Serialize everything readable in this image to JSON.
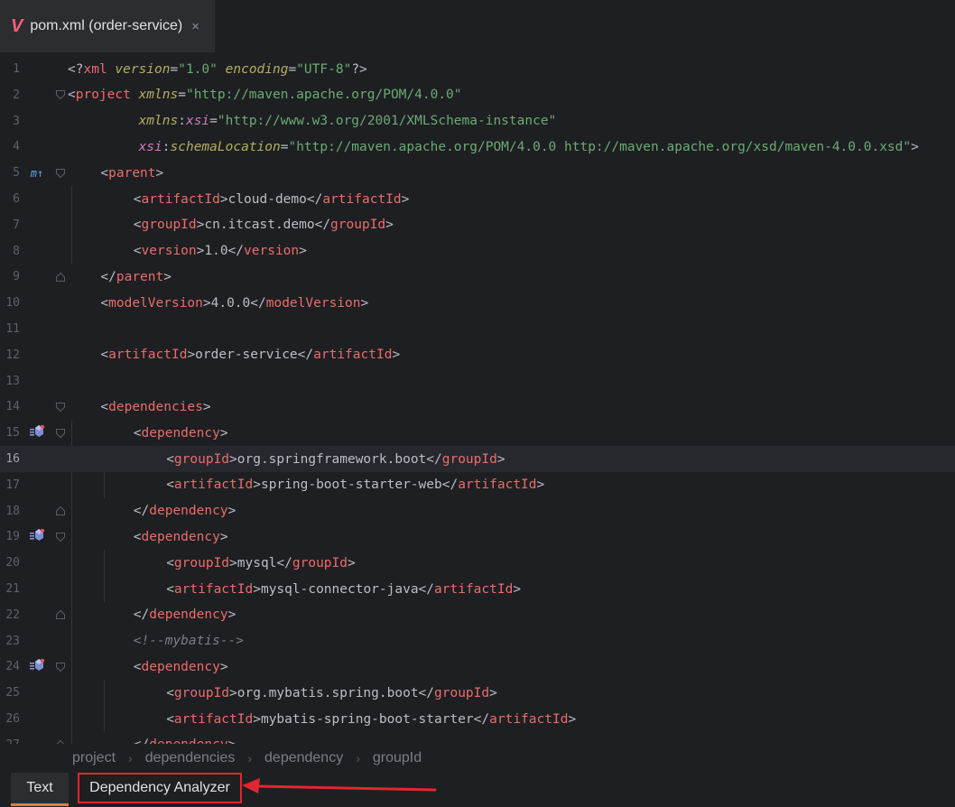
{
  "tab": {
    "logo": "V",
    "title": "pom.xml (order-service)",
    "close": "×"
  },
  "editor": {
    "current_line": 16,
    "lines": [
      {
        "n": "1",
        "indent": 0,
        "parts": [
          [
            "b",
            "<?"
          ],
          [
            "t",
            "xml "
          ],
          [
            "a",
            "version"
          ],
          [
            "b",
            "="
          ],
          [
            "v",
            "\"1.0\" "
          ],
          [
            "a",
            "encoding"
          ],
          [
            "b",
            "="
          ],
          [
            "v",
            "\"UTF-8\""
          ],
          [
            "b",
            "?>"
          ]
        ]
      },
      {
        "n": "2",
        "indent": 0,
        "fold": "open",
        "parts": [
          [
            "b",
            "<"
          ],
          [
            "t",
            "project "
          ],
          [
            "a",
            "xmlns"
          ],
          [
            "b",
            "="
          ],
          [
            "v",
            "\"http://maven.apache.org/POM/4.0.0\""
          ]
        ]
      },
      {
        "n": "3",
        "indent": 0,
        "parts": [
          [
            "b",
            "         "
          ],
          [
            "a",
            "xmlns"
          ],
          [
            "b",
            ":"
          ],
          [
            "n",
            "xsi"
          ],
          [
            "b",
            "="
          ],
          [
            "v",
            "\"http://www.w3.org/2001/XMLSchema-instance\""
          ]
        ]
      },
      {
        "n": "4",
        "indent": 0,
        "parts": [
          [
            "b",
            "         "
          ],
          [
            "n",
            "xsi"
          ],
          [
            "b",
            ":"
          ],
          [
            "a",
            "schemaLocation"
          ],
          [
            "b",
            "="
          ],
          [
            "v",
            "\"http://maven.apache.org/POM/4.0.0 http://maven.apache.org/xsd/maven-4.0.0.xsd\""
          ],
          [
            "b",
            ">"
          ]
        ]
      },
      {
        "n": "5",
        "indent": 1,
        "fold": "open",
        "gicon": "m↑",
        "parts": [
          [
            "b",
            "<"
          ],
          [
            "t",
            "parent"
          ],
          [
            "b",
            ">"
          ]
        ]
      },
      {
        "n": "6",
        "indent": 2,
        "parts": [
          [
            "b",
            "<"
          ],
          [
            "t",
            "artifactId"
          ],
          [
            "b",
            ">cloud-demo</"
          ],
          [
            "t",
            "artifactId"
          ],
          [
            "b",
            ">"
          ]
        ]
      },
      {
        "n": "7",
        "indent": 2,
        "parts": [
          [
            "b",
            "<"
          ],
          [
            "t",
            "groupId"
          ],
          [
            "b",
            ">cn.itcast.demo</"
          ],
          [
            "t",
            "groupId"
          ],
          [
            "b",
            ">"
          ]
        ]
      },
      {
        "n": "8",
        "indent": 2,
        "parts": [
          [
            "b",
            "<"
          ],
          [
            "t",
            "version"
          ],
          [
            "b",
            ">1.0</"
          ],
          [
            "t",
            "version"
          ],
          [
            "b",
            ">"
          ]
        ]
      },
      {
        "n": "9",
        "indent": 1,
        "fold": "close",
        "parts": [
          [
            "b",
            "</"
          ],
          [
            "t",
            "parent"
          ],
          [
            "b",
            ">"
          ]
        ]
      },
      {
        "n": "10",
        "indent": 1,
        "parts": [
          [
            "b",
            "<"
          ],
          [
            "t",
            "modelVersion"
          ],
          [
            "b",
            ">4.0.0</"
          ],
          [
            "t",
            "modelVersion"
          ],
          [
            "b",
            ">"
          ]
        ]
      },
      {
        "n": "11",
        "indent": 0,
        "parts": []
      },
      {
        "n": "12",
        "indent": 1,
        "parts": [
          [
            "b",
            "<"
          ],
          [
            "t",
            "artifactId"
          ],
          [
            "b",
            ">order-service</"
          ],
          [
            "t",
            "artifactId"
          ],
          [
            "b",
            ">"
          ]
        ]
      },
      {
        "n": "13",
        "indent": 0,
        "parts": []
      },
      {
        "n": "14",
        "indent": 1,
        "fold": "open",
        "parts": [
          [
            "b",
            "<"
          ],
          [
            "t",
            "dependencies"
          ],
          [
            "b",
            ">"
          ]
        ]
      },
      {
        "n": "15",
        "indent": 2,
        "fold": "open",
        "gicon": "dep",
        "parts": [
          [
            "b",
            "<"
          ],
          [
            "t",
            "dependency"
          ],
          [
            "b",
            ">"
          ]
        ]
      },
      {
        "n": "16",
        "indent": 3,
        "parts": [
          [
            "b",
            "<"
          ],
          [
            "t",
            "groupId"
          ],
          [
            "b",
            ">org.springframework.boot</"
          ],
          [
            "t",
            "groupId"
          ],
          [
            "b",
            ">"
          ]
        ]
      },
      {
        "n": "17",
        "indent": 3,
        "parts": [
          [
            "b",
            "<"
          ],
          [
            "t",
            "artifactId"
          ],
          [
            "b",
            ">spring-boot-starter-web</"
          ],
          [
            "t",
            "artifactId"
          ],
          [
            "b",
            ">"
          ]
        ]
      },
      {
        "n": "18",
        "indent": 2,
        "fold": "close",
        "parts": [
          [
            "b",
            "</"
          ],
          [
            "t",
            "dependency"
          ],
          [
            "b",
            ">"
          ]
        ]
      },
      {
        "n": "19",
        "indent": 2,
        "fold": "open",
        "gicon": "dep",
        "parts": [
          [
            "b",
            "<"
          ],
          [
            "t",
            "dependency"
          ],
          [
            "b",
            ">"
          ]
        ]
      },
      {
        "n": "20",
        "indent": 3,
        "parts": [
          [
            "b",
            "<"
          ],
          [
            "t",
            "groupId"
          ],
          [
            "b",
            ">mysql</"
          ],
          [
            "t",
            "groupId"
          ],
          [
            "b",
            ">"
          ]
        ]
      },
      {
        "n": "21",
        "indent": 3,
        "parts": [
          [
            "b",
            "<"
          ],
          [
            "t",
            "artifactId"
          ],
          [
            "b",
            ">mysql-connector-java</"
          ],
          [
            "t",
            "artifactId"
          ],
          [
            "b",
            ">"
          ]
        ]
      },
      {
        "n": "22",
        "indent": 2,
        "fold": "close",
        "parts": [
          [
            "b",
            "</"
          ],
          [
            "t",
            "dependency"
          ],
          [
            "b",
            ">"
          ]
        ]
      },
      {
        "n": "23",
        "indent": 2,
        "parts": [
          [
            "c",
            "<!--mybatis-->"
          ]
        ]
      },
      {
        "n": "24",
        "indent": 2,
        "fold": "open",
        "gicon": "dep",
        "parts": [
          [
            "b",
            "<"
          ],
          [
            "t",
            "dependency"
          ],
          [
            "b",
            ">"
          ]
        ]
      },
      {
        "n": "25",
        "indent": 3,
        "parts": [
          [
            "b",
            "<"
          ],
          [
            "t",
            "groupId"
          ],
          [
            "b",
            ">org.mybatis.spring.boot</"
          ],
          [
            "t",
            "groupId"
          ],
          [
            "b",
            ">"
          ]
        ]
      },
      {
        "n": "26",
        "indent": 3,
        "parts": [
          [
            "b",
            "<"
          ],
          [
            "t",
            "artifactId"
          ],
          [
            "b",
            ">mybatis-spring-boot-starter</"
          ],
          [
            "t",
            "artifactId"
          ],
          [
            "b",
            ">"
          ]
        ]
      },
      {
        "n": "27",
        "indent": 2,
        "fold": "close",
        "parts": [
          [
            "b",
            "</"
          ],
          [
            "t",
            "dependency"
          ],
          [
            "b",
            ">"
          ]
        ]
      }
    ]
  },
  "breadcrumb": [
    "project",
    "dependencies",
    "dependency",
    "groupId"
  ],
  "bottom_tabs": {
    "text": "Text",
    "dependency_analyzer": "Dependency Analyzer"
  },
  "colors": {
    "tag": "#ea6c6c",
    "attribute": "#b3ae60",
    "value": "#6aab73",
    "comment": "#7a7e85",
    "accent": "#d9813a",
    "highlight": "#e3262e"
  }
}
